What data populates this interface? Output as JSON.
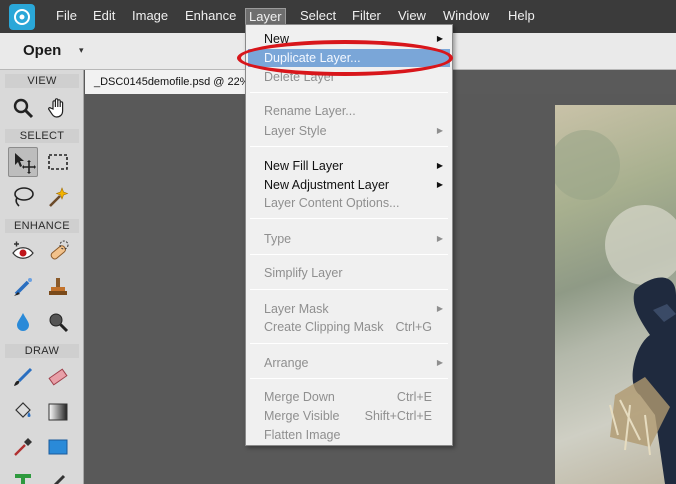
{
  "menubar": {
    "items": [
      "File",
      "Edit",
      "Image",
      "Enhance",
      "Layer",
      "Select",
      "Filter",
      "View",
      "Window",
      "Help"
    ],
    "active": "Layer"
  },
  "toolbar": {
    "open_label": "Open",
    "open_arrow": "▾"
  },
  "panel": {
    "sections": [
      "VIEW",
      "SELECT",
      "ENHANCE",
      "DRAW"
    ],
    "tools": [
      "zoom-tool-icon",
      "hand-tool-icon",
      "move-tool-icon",
      "marquee-tool-icon",
      "lasso-tool-icon",
      "magic-wand-icon",
      "red-eye-tool-icon",
      "spot-healing-brush-icon",
      "smart-brush-icon",
      "clone-stamp-icon",
      "blur-tool-icon",
      "sponge-tool-icon",
      "brush-tool-icon",
      "eraser-tool-icon",
      "paint-bucket-icon",
      "gradient-tool-icon",
      "eyedropper-icon",
      "shape-tool-icon",
      "type-tool-icon",
      "pencil-tool-icon"
    ]
  },
  "document": {
    "tab_label": "_DSC0145demofile.psd @ 22%"
  },
  "layer_menu": {
    "items": [
      {
        "label": "New",
        "submenu": true,
        "disabled": false
      },
      {
        "label": "Duplicate Layer...",
        "submenu": false,
        "disabled": false,
        "highlighted": true
      },
      {
        "label": "Delete Layer",
        "submenu": false,
        "disabled": true
      },
      {
        "label": "Rename Layer...",
        "submenu": false,
        "disabled": true
      },
      {
        "label": "Layer Style",
        "submenu": true,
        "disabled": true
      },
      {
        "label": "New Fill Layer",
        "submenu": true,
        "disabled": false
      },
      {
        "label": "New Adjustment Layer",
        "submenu": true,
        "disabled": false
      },
      {
        "label": "Layer Content Options...",
        "submenu": false,
        "disabled": true
      },
      {
        "label": "Type",
        "submenu": true,
        "disabled": true
      },
      {
        "label": "Simplify Layer",
        "submenu": false,
        "disabled": true
      },
      {
        "label": "Layer Mask",
        "submenu": true,
        "disabled": true
      },
      {
        "label": "Create Clipping Mask",
        "shortcut": "Ctrl+G",
        "submenu": false,
        "disabled": true
      },
      {
        "label": "Arrange",
        "submenu": true,
        "disabled": true
      },
      {
        "label": "Merge Down",
        "shortcut": "Ctrl+E",
        "submenu": false,
        "disabled": true
      },
      {
        "label": "Merge Visible",
        "shortcut": "Shift+Ctrl+E",
        "submenu": false,
        "disabled": true
      },
      {
        "label": "Flatten Image",
        "submenu": false,
        "disabled": true
      }
    ],
    "submenu_arrow": "▶"
  },
  "colors": {
    "menubar_bg": "#3b3b3b",
    "highlight": "#7aa6d8",
    "annotation_red": "#d8161b",
    "app_logo": "#2aa7d8"
  }
}
